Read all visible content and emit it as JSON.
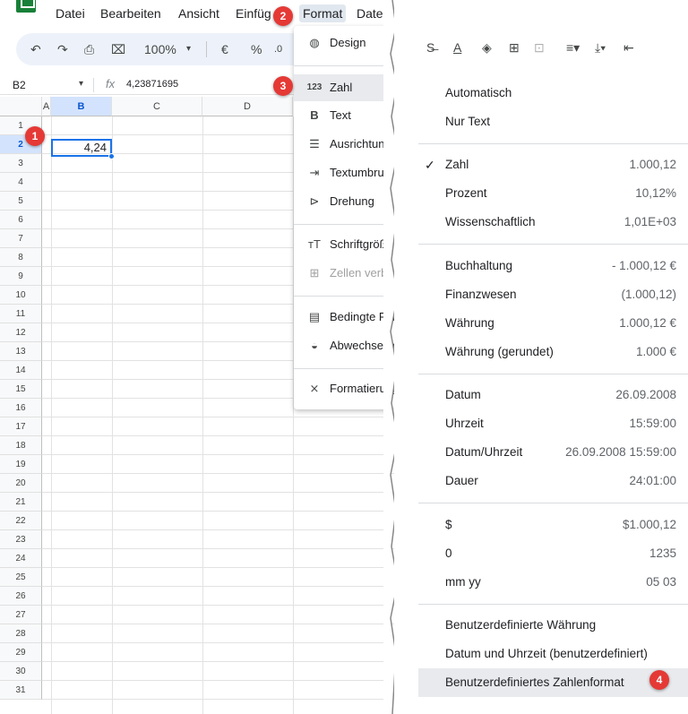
{
  "menubar": {
    "items": [
      "Datei",
      "Bearbeiten",
      "Ansicht",
      "Einfüg",
      "Format",
      "Daten"
    ]
  },
  "toolbar": {
    "zoom": "100%",
    "currency": "€",
    "percent": "%",
    "decimal": ".0"
  },
  "formula_bar": {
    "cell_ref": "B2",
    "fx": "fx",
    "value": "4,23871695"
  },
  "columns": [
    "A",
    "B",
    "C",
    "D"
  ],
  "rows": [
    "1",
    "2",
    "3",
    "4",
    "5",
    "6",
    "7",
    "8",
    "9",
    "10",
    "11",
    "12",
    "13",
    "14",
    "15",
    "16",
    "17",
    "18",
    "19",
    "20",
    "21",
    "22",
    "23",
    "24",
    "25",
    "26",
    "27",
    "28",
    "29",
    "30",
    "31"
  ],
  "active_cell": {
    "display": "4,24"
  },
  "format_menu": {
    "items": [
      "Design",
      "Zahl",
      "Text",
      "Ausrichtung",
      "Textumbruch",
      "Drehung",
      "Schriftgröße",
      "Zellen verbinden",
      "Bedingte Formatierung",
      "Abwechselnde Farben",
      "Formatierung löschen"
    ],
    "zahl_icon": "123"
  },
  "number_menu": {
    "automatic": "Automatisch",
    "plain_text": "Nur Text",
    "number": {
      "label": "Zahl",
      "value": "1.000,12"
    },
    "percent": {
      "label": "Prozent",
      "value": "10,12%"
    },
    "scientific": {
      "label": "Wissenschaftlich",
      "value": "1,01E+03"
    },
    "accounting": {
      "label": "Buchhaltung",
      "value": "- 1.000,12 €"
    },
    "financial": {
      "label": "Finanzwesen",
      "value": "(1.000,12)"
    },
    "currency": {
      "label": "Währung",
      "value": "1.000,12 €"
    },
    "currency_rounded": {
      "label": "Währung (gerundet)",
      "value": "1.000 €"
    },
    "date": {
      "label": "Datum",
      "value": "26.09.2008"
    },
    "time": {
      "label": "Uhrzeit",
      "value": "15:59:00"
    },
    "datetime": {
      "label": "Datum/Uhrzeit",
      "value": "26.09.2008 15:59:00"
    },
    "duration": {
      "label": "Dauer",
      "value": "24:01:00"
    },
    "dollar": {
      "label": "$",
      "value": "$1.000,12"
    },
    "zero": {
      "label": "0",
      "value": "1235"
    },
    "mmyy": {
      "label": "mm yy",
      "value": "05 03"
    },
    "custom_currency": "Benutzerdefinierte Währung",
    "custom_datetime": "Datum und Uhrzeit (benutzerdefiniert)",
    "custom_number": "Benutzerdefiniertes Zahlenformat"
  },
  "badges": [
    "1",
    "2",
    "3",
    "4"
  ],
  "colors": {
    "accent": "#1a73e8",
    "badge": "#e53935",
    "sheets_green": "#188038"
  }
}
